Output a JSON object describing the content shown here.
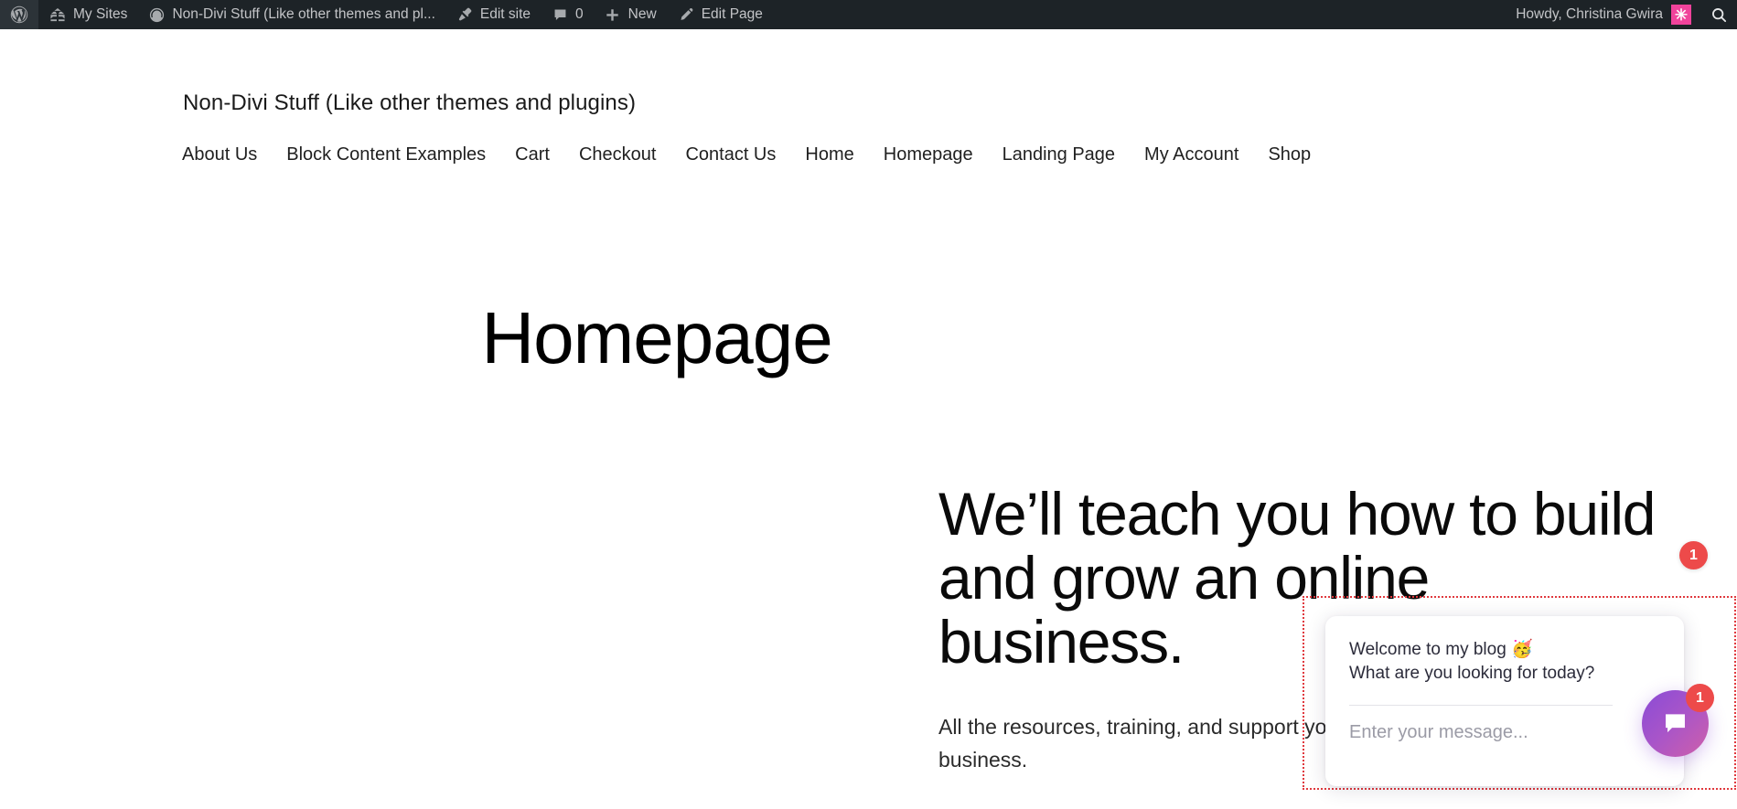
{
  "admin_bar": {
    "left_items": [
      {
        "id": "wp-logo",
        "icon": "wordpress-logo-icon",
        "label": ""
      },
      {
        "id": "my-sites",
        "icon": "sites-icon",
        "label": "My Sites"
      },
      {
        "id": "site-name",
        "icon": "dashboard-gauge-icon",
        "label": "Non-Divi Stuff (Like other themes and pl..."
      },
      {
        "id": "edit-site",
        "icon": "paintbrush-icon",
        "label": "Edit site"
      },
      {
        "id": "comments",
        "icon": "comment-bubble-icon",
        "label": "0"
      },
      {
        "id": "new",
        "icon": "plus-icon",
        "label": "New"
      },
      {
        "id": "edit-page",
        "icon": "pencil-icon",
        "label": "Edit Page"
      }
    ],
    "howdy": "Howdy, Christina Gwira",
    "avatar_glyph": "✳",
    "search_icon": "search-icon",
    "bar_color": "#1d2327",
    "text_color": "#c3c4c7",
    "avatar_color": "#f0439b"
  },
  "site": {
    "title": "Non-Divi Stuff (Like other themes and plugins)",
    "nav": [
      {
        "label": "About Us"
      },
      {
        "label": "Block Content Examples"
      },
      {
        "label": "Cart"
      },
      {
        "label": "Checkout"
      },
      {
        "label": "Contact Us"
      },
      {
        "label": "Home"
      },
      {
        "label": "Homepage"
      },
      {
        "label": "Landing Page"
      },
      {
        "label": "My Account"
      },
      {
        "label": "Shop"
      }
    ]
  },
  "main": {
    "page_title": "Homepage",
    "hero_heading": "We’ll teach you how to build and grow an online business.",
    "hero_paragraph": "All the resources, training, and support you need to run your dream online business."
  },
  "chat_widget": {
    "greeting": "Welcome to my blog 🥳\nWhat are you looking for today?",
    "input_placeholder": "Enter your message...",
    "input_value": "",
    "launcher_icon": "chat-bubble-icon",
    "launcher_badge_count": "1",
    "floating_badge_count": "1",
    "badge_color": "#ed4a4a",
    "gradient_start": "#8a4bd6",
    "gradient_end": "#cf5fa9",
    "outline_color": "#e0393e"
  }
}
